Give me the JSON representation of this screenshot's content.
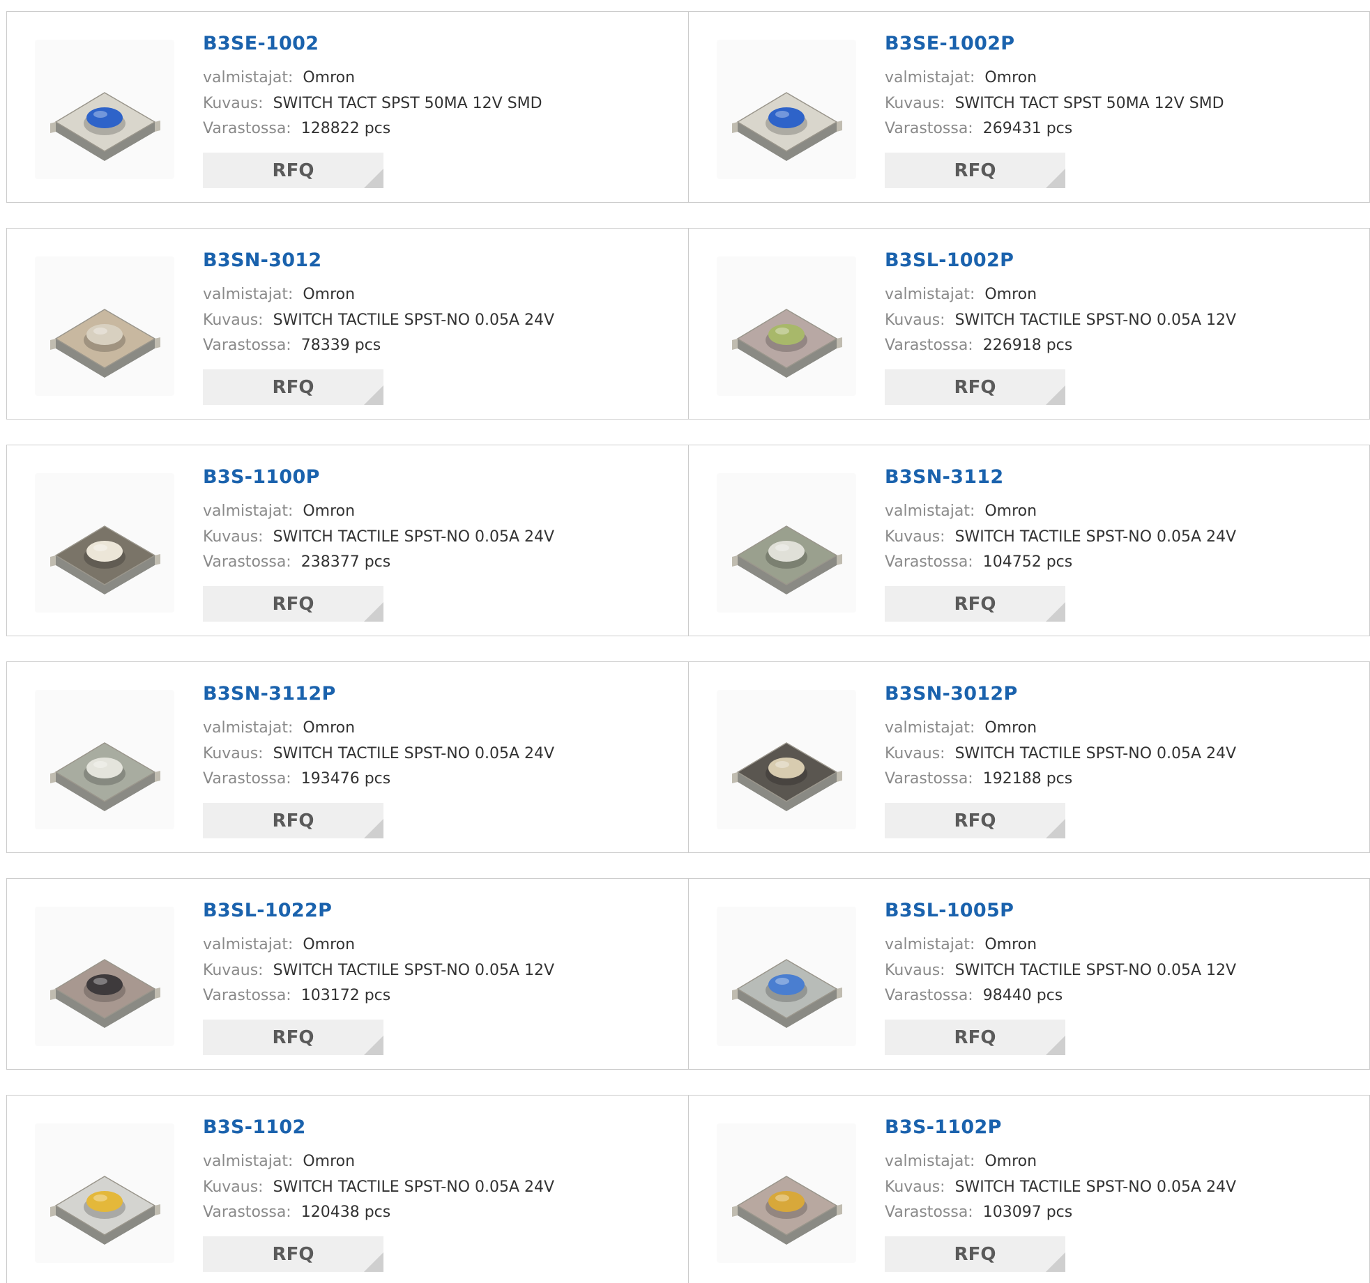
{
  "labels": {
    "manufacturer": "valmistajat:",
    "description": "Kuvaus:",
    "stock": "Varastossa:",
    "rfq": "RFQ"
  },
  "products": [
    {
      "part": "B3SE-1002",
      "manufacturer": "Omron",
      "description": "SWITCH TACT SPST 50MA 12V SMD",
      "stock": "128822 pcs",
      "cap_color": "#2e63c9",
      "body_color": "#d9d6cc"
    },
    {
      "part": "B3SE-1002P",
      "manufacturer": "Omron",
      "description": "SWITCH TACT SPST 50MA 12V SMD",
      "stock": "269431 pcs",
      "cap_color": "#2e63c9",
      "body_color": "#d9d6cc"
    },
    {
      "part": "B3SN-3012",
      "manufacturer": "Omron",
      "description": "SWITCH TACTILE SPST-NO 0.05A 24V",
      "stock": "78339 pcs",
      "cap_color": "#d8d0c0",
      "body_color": "#c8b8a0"
    },
    {
      "part": "B3SL-1002P",
      "manufacturer": "Omron",
      "description": "SWITCH TACTILE SPST-NO 0.05A 12V",
      "stock": "226918 pcs",
      "cap_color": "#a8b86a",
      "body_color": "#b8a8a4"
    },
    {
      "part": "B3S-1100P",
      "manufacturer": "Omron",
      "description": "SWITCH TACTILE SPST-NO 0.05A 24V",
      "stock": "238377 pcs",
      "cap_color": "#ece6d8",
      "body_color": "#7a7468"
    },
    {
      "part": "B3SN-3112",
      "manufacturer": "Omron",
      "description": "SWITCH TACTILE SPST-NO 0.05A 24V",
      "stock": "104752 pcs",
      "cap_color": "#e0e0d8",
      "body_color": "#9aa08e"
    },
    {
      "part": "B3SN-3112P",
      "manufacturer": "Omron",
      "description": "SWITCH TACTILE SPST-NO 0.05A 24V",
      "stock": "193476 pcs",
      "cap_color": "#e4e4dc",
      "body_color": "#a8aca0"
    },
    {
      "part": "B3SN-3012P",
      "manufacturer": "Omron",
      "description": "SWITCH TACTILE SPST-NO 0.05A 24V",
      "stock": "192188 pcs",
      "cap_color": "#d8ccb0",
      "body_color": "#5a5650"
    },
    {
      "part": "B3SL-1022P",
      "manufacturer": "Omron",
      "description": "SWITCH TACTILE SPST-NO 0.05A 12V",
      "stock": "103172 pcs",
      "cap_color": "#3e3a3c",
      "body_color": "#a89890"
    },
    {
      "part": "B3SL-1005P",
      "manufacturer": "Omron",
      "description": "SWITCH TACTILE SPST-NO 0.05A 12V",
      "stock": "98440 pcs",
      "cap_color": "#4a7ed0",
      "body_color": "#b8bcb8"
    },
    {
      "part": "B3S-1102",
      "manufacturer": "Omron",
      "description": "SWITCH TACTILE SPST-NO 0.05A 24V",
      "stock": "120438 pcs",
      "cap_color": "#e4b83a",
      "body_color": "#d4d4d0"
    },
    {
      "part": "B3S-1102P",
      "manufacturer": "Omron",
      "description": "SWITCH TACTILE SPST-NO 0.05A 24V",
      "stock": "103097 pcs",
      "cap_color": "#d8a83a",
      "body_color": "#b8a8a0"
    }
  ]
}
